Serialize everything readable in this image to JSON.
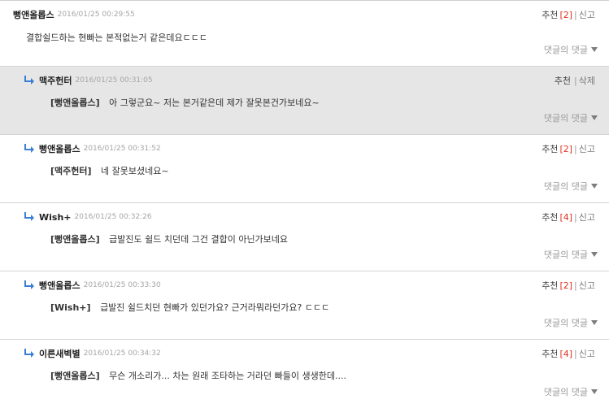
{
  "comments": [
    {
      "author": "뻥앤올롭스",
      "time": "2016/01/25 00:29:55",
      "mention": "",
      "text": "결합쉴드하는 현빠는 본적없는거 같은데요ㄷㄷㄷ",
      "recommend": "추천",
      "count": "[2]",
      "sep": "|",
      "action": "신고",
      "subreply": "댓글의 댓글",
      "reply": false,
      "highlighted": false
    },
    {
      "author": "맥주헌터",
      "time": "2016/01/25 00:31:05",
      "mention": "[뻥앤올롭스]",
      "text": "아 그렇군요~ 저는 본거같은데 제가 잘못본건가보네요~",
      "recommend": "추천",
      "count": "",
      "sep": "|",
      "action": "삭제",
      "subreply": "댓글의 댓글",
      "reply": true,
      "highlighted": true
    },
    {
      "author": "뻥앤올롭스",
      "time": "2016/01/25 00:31:52",
      "mention": "[맥주헌터]",
      "text": "네 잘못보셨네요~",
      "recommend": "추천",
      "count": "[2]",
      "sep": "|",
      "action": "신고",
      "subreply": "댓글의 댓글",
      "reply": true,
      "highlighted": false
    },
    {
      "author": "Wish+",
      "time": "2016/01/25 00:32:26",
      "mention": "[뻥앤올롭스]",
      "text": "급발진도 쉴드 치던데 그건 결합이 아닌가보네요",
      "recommend": "추천",
      "count": "[4]",
      "sep": "|",
      "action": "신고",
      "subreply": "댓글의 댓글",
      "reply": true,
      "highlighted": false
    },
    {
      "author": "뻥앤올롭스",
      "time": "2016/01/25 00:33:30",
      "mention": "[Wish+]",
      "text": "급발진 쉴드치던 현빠가 있던가요? 근거라뭐라던가요? ㄷㄷㄷ",
      "recommend": "추천",
      "count": "[2]",
      "sep": "|",
      "action": "신고",
      "subreply": "댓글의 댓글",
      "reply": true,
      "highlighted": false
    },
    {
      "author": "이른새벽별",
      "time": "2016/01/25 00:34:32",
      "mention": "[뻥앤올롭스]",
      "text": "무슨 개소리가... 차는 원래 조타하는 거라던 빠들이 생생한데....",
      "recommend": "추천",
      "count": "[4]",
      "sep": "|",
      "action": "신고",
      "subreply": "댓글의 댓글",
      "reply": true,
      "highlighted": false
    }
  ],
  "colors": {
    "count": "#e0301e",
    "highlight_bg": "#e6e6e6",
    "reply_icon": "#3a7fd5"
  },
  "icons": {
    "reply": "reply-arrow-icon",
    "expand": "triangle-down-icon"
  }
}
